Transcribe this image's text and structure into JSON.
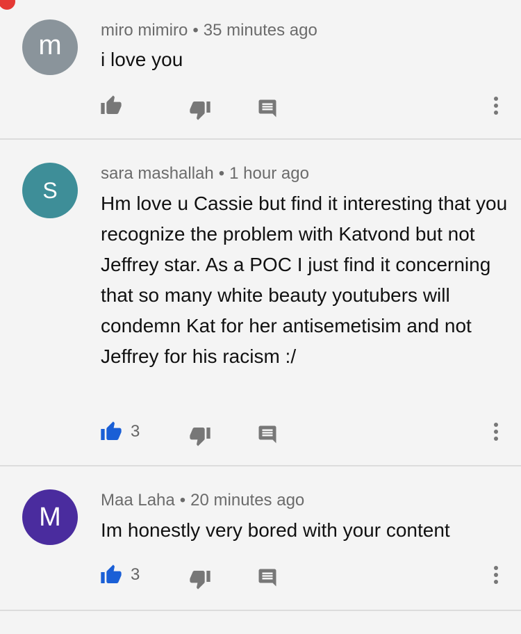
{
  "colors": {
    "like_active": "#1a5fd6",
    "icon_gray": "#777777",
    "notification_dot": "#e53935"
  },
  "comments": [
    {
      "author": "miro mimiro",
      "separator": "•",
      "time": "35 minutes ago",
      "text": "i love you",
      "avatar": {
        "letter": "m",
        "color": "#8a949b"
      },
      "like_count": "",
      "liked": false
    },
    {
      "author": "sara mashallah",
      "separator": "•",
      "time": "1 hour ago",
      "text": "Hm love u Cassie but find it interesting that you recognize the problem with Katvond but not Jeffrey star. As a POC I just find it concerning that so many white beauty youtubers will condemn Kat for her antisemetisim and not Jeffrey for his racism :/",
      "avatar": {
        "letter": "S",
        "color": "#3e8e98"
      },
      "like_count": "3",
      "liked": true
    },
    {
      "author": "Maa Laha",
      "separator": "•",
      "time": "20 minutes ago",
      "text": "Im honestly very bored with your content",
      "avatar": {
        "letter": "M",
        "color": "#4a2c9e"
      },
      "like_count": "3",
      "liked": true
    }
  ]
}
